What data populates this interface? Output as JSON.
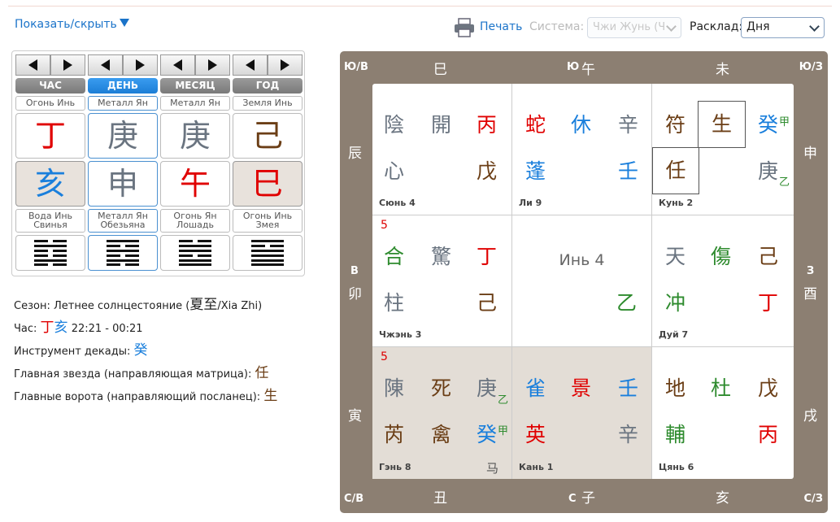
{
  "toolbar": {
    "toggle_label": "Показать/скрыть",
    "print_label": "Печать",
    "system_label": "Система:",
    "system_value": "Чжи Жунь (Ч",
    "layout_label": "Расклад:",
    "layout_value": "Дня"
  },
  "pillars": [
    {
      "title": "ЧАС",
      "active": false,
      "stem_element": "Огонь Инь",
      "stem": "丁",
      "stem_color": "#e00000",
      "branch": "亥",
      "branch_color": "#1a7fdc",
      "branch_shade": true,
      "branch_element_line1": "Вода Инь",
      "branch_element_line2": "Свинья"
    },
    {
      "title": "ДЕНЬ",
      "active": true,
      "stem_element": "Металл Ян",
      "stem": "庚",
      "stem_color": "#6a7480",
      "branch": "申",
      "branch_color": "#6a7480",
      "branch_shade": false,
      "branch_element_line1": "Металл Ян",
      "branch_element_line2": "Обезьяна"
    },
    {
      "title": "МЕСЯЦ",
      "active": false,
      "stem_element": "Металл Ян",
      "stem": "庚",
      "stem_color": "#6a7480",
      "branch": "午",
      "branch_color": "#e00000",
      "branch_shade": false,
      "branch_element_line1": "Огонь Ян",
      "branch_element_line2": "Лошадь"
    },
    {
      "title": "ГОД",
      "active": false,
      "stem_element": "Земля Инь",
      "stem": "己",
      "stem_color": "#6b3e16",
      "branch": "巳",
      "branch_color": "#e00000",
      "branch_shade": true,
      "branch_element_line1": "Огонь Инь",
      "branch_element_line2": "Змея"
    }
  ],
  "info": {
    "season_label": "Сезон:",
    "season_value": "Летнее солнцестояние (",
    "season_chars": "夏至",
    "season_pinyin": "/Xia Zhi)",
    "hour_label": "Час:",
    "hour_stem": "丁",
    "hour_branch": "亥",
    "hour_time": "22:21 - 00:21",
    "decade_label": "Инструмент декады:",
    "decade_char": "癸",
    "star_label": "Главная звезда (направляющая матрица):",
    "star_char": "任",
    "gate_label": "Главные ворота (направляющий посланец):",
    "gate_char": "生"
  },
  "board": {
    "corners": {
      "nw": "Ю/В",
      "ne": "Ю/З",
      "sw": "С/В",
      "se": "С/З"
    },
    "top": {
      "left": "巳",
      "mid_dir": "Ю",
      "mid": "午",
      "right": "未"
    },
    "bottom": {
      "left": "丑",
      "mid_dir": "С",
      "mid": "子",
      "right": "亥"
    },
    "left_side": {
      "top": "辰",
      "mid_dir": "В",
      "mid": "卯",
      "bottom": "寅"
    },
    "right_side": {
      "top": "申",
      "mid_dir": "З",
      "mid": "酉",
      "bottom": "戌"
    },
    "center_label": "Инь 4",
    "palaces": {
      "xun": {
        "name": "Сюнь 4",
        "deity": "陰",
        "gate": "開",
        "heaven": "丙",
        "star": "心",
        "earth": "戊"
      },
      "li": {
        "name": "Ли 9",
        "deity": "蛇",
        "gate": "休",
        "heaven": "辛",
        "star": "蓬",
        "earth": "壬"
      },
      "kun": {
        "name": "Кунь 2",
        "deity": "符",
        "gate": "生",
        "heaven": "癸",
        "heaven_sup": "甲",
        "star": "任",
        "earth": "庚",
        "earth_sup": "乙"
      },
      "zhen": {
        "name": "Чжэнь 3",
        "num": "5",
        "deity": "合",
        "gate": "驚",
        "heaven": "丁",
        "star": "柱",
        "earth": "己"
      },
      "dui": {
        "name": "Дуй 7",
        "deity": "天",
        "gate": "傷",
        "heaven": "己",
        "star": "冲",
        "earth": "丁"
      },
      "gen": {
        "name": "Гэнь 8",
        "num": "5",
        "deity": "陳",
        "gate": "死",
        "heaven": "庚",
        "heaven_sup": "乙",
        "star": "芮",
        "mid": "禽",
        "earth": "癸",
        "earth_sup": "甲",
        "horse": "马"
      },
      "kan": {
        "name": "Кань 1",
        "deity": "雀",
        "gate": "景",
        "heaven": "壬",
        "star": "英",
        "earth": "辛"
      },
      "qian": {
        "name": "Цянь 6",
        "deity": "地",
        "gate": "杜",
        "heaven": "戊",
        "star": "輔",
        "earth": "丙"
      }
    }
  }
}
